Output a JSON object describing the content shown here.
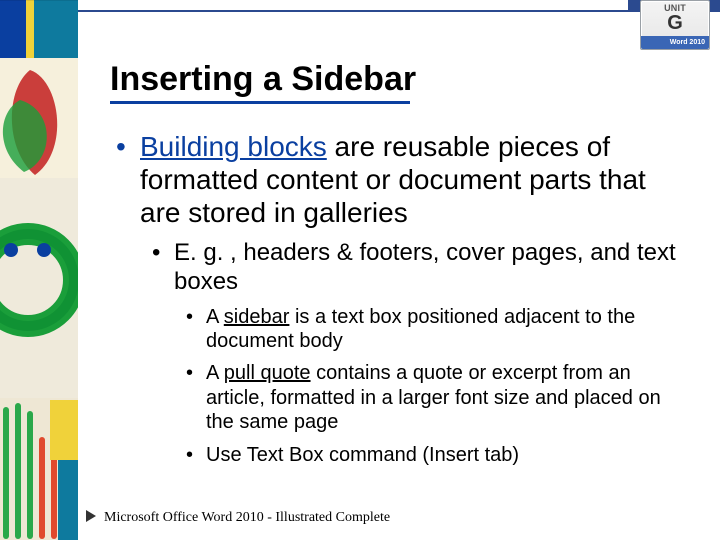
{
  "badge": {
    "unit_label": "UNIT",
    "unit_letter": "G",
    "product": "Word 2010"
  },
  "title": "Inserting a Sidebar",
  "bullets": {
    "l1": {
      "key": "Building blocks",
      "rest": " are reusable pieces of formatted content or document parts that are stored in galleries"
    },
    "l2": {
      "text": "E. g. , headers & footers, cover pages, and text boxes"
    },
    "l3a": {
      "pre": "A ",
      "key": "sidebar",
      "post": " is a text box positioned adjacent to the document body"
    },
    "l3b": {
      "pre": "A ",
      "key": "pull quote",
      "post": " contains a quote or excerpt from an article, formatted in a larger font size and placed on the same page"
    },
    "l3c": {
      "text": "Use Text Box command (Insert tab)"
    }
  },
  "footer": "Microsoft Office Word 2010 - Illustrated Complete"
}
